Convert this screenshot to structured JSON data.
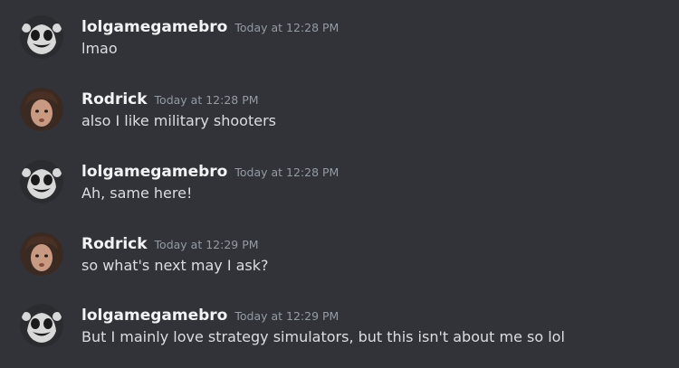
{
  "messages": [
    {
      "author": "lolgamegamebro",
      "avatar_icon": "mascot-avatar-icon",
      "timestamp": "Today at 12:28 PM",
      "text": "lmao"
    },
    {
      "author": "Rodrick",
      "avatar_icon": "person-avatar-icon",
      "timestamp": "Today at 12:28 PM",
      "text": "also I like military shooters"
    },
    {
      "author": "lolgamegamebro",
      "avatar_icon": "mascot-avatar-icon",
      "timestamp": "Today at 12:28 PM",
      "text": "Ah, same here!"
    },
    {
      "author": "Rodrick",
      "avatar_icon": "person-avatar-icon",
      "timestamp": "Today at 12:29 PM",
      "text": "so what's next may I ask?"
    },
    {
      "author": "lolgamegamebro",
      "avatar_icon": "mascot-avatar-icon",
      "timestamp": "Today at 12:29 PM",
      "text": "But I mainly love strategy simulators, but this isn't about me so lol"
    }
  ],
  "colors": {
    "background": "#313338",
    "username": "#f2f3f5",
    "timestamp": "#949ba4",
    "message_text": "#dbdee1"
  }
}
